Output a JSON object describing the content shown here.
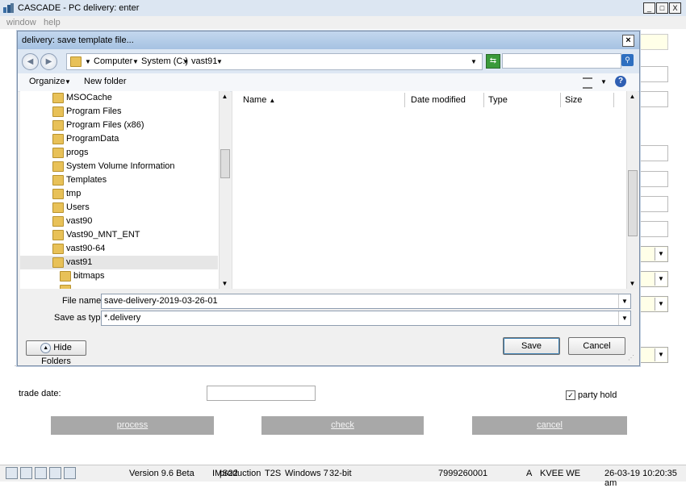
{
  "window": {
    "title": "CASCADE - PC delivery: enter",
    "btn_min": "_",
    "btn_max": "□",
    "btn_close": "X"
  },
  "menu": {
    "items": [
      "window",
      "help"
    ]
  },
  "dialog": {
    "title": "delivery: save template file...",
    "close": "×",
    "address": [
      "Computer",
      "System (C:)",
      "vast91"
    ],
    "toolbar": {
      "organize": "Organize",
      "new_folder": "New folder"
    },
    "tree_items": [
      "MSOCache",
      "Program Files",
      "Program Files (x86)",
      "ProgramData",
      "progs",
      "System Volume Information",
      "Templates",
      "tmp",
      "Users",
      "vast90",
      "Vast90_MNT_ENT",
      "vast90-64",
      "vast91",
      "bitmaps"
    ],
    "selected_tree_item": "vast91",
    "columns": [
      "Name",
      "Date modified",
      "Type",
      "Size"
    ],
    "file_name_label": "File name:",
    "file_name_value": "save-delivery-2019-03-26-01",
    "save_type_label": "Save as type:",
    "save_type_value": "*.delivery",
    "hide_folders": "Hide Folders",
    "save": "Save",
    "cancel": "Cancel"
  },
  "form": {
    "trade_date_label": "trade date:",
    "trade_date_value": "",
    "party_hold_label": "party hold",
    "party_hold_checked": true,
    "process": "process",
    "check": "check",
    "cancel": "cancel"
  },
  "status": {
    "version": "Version 9.6 Beta",
    "ims": "IMS22",
    "env": "production",
    "t2s": "T2S",
    "os": "Windows 7",
    "bits": "32-bit",
    "number": "7999260001",
    "flag": "A",
    "user": "KVEE WE",
    "datetime": "26-03-19 10:20:35 am"
  }
}
